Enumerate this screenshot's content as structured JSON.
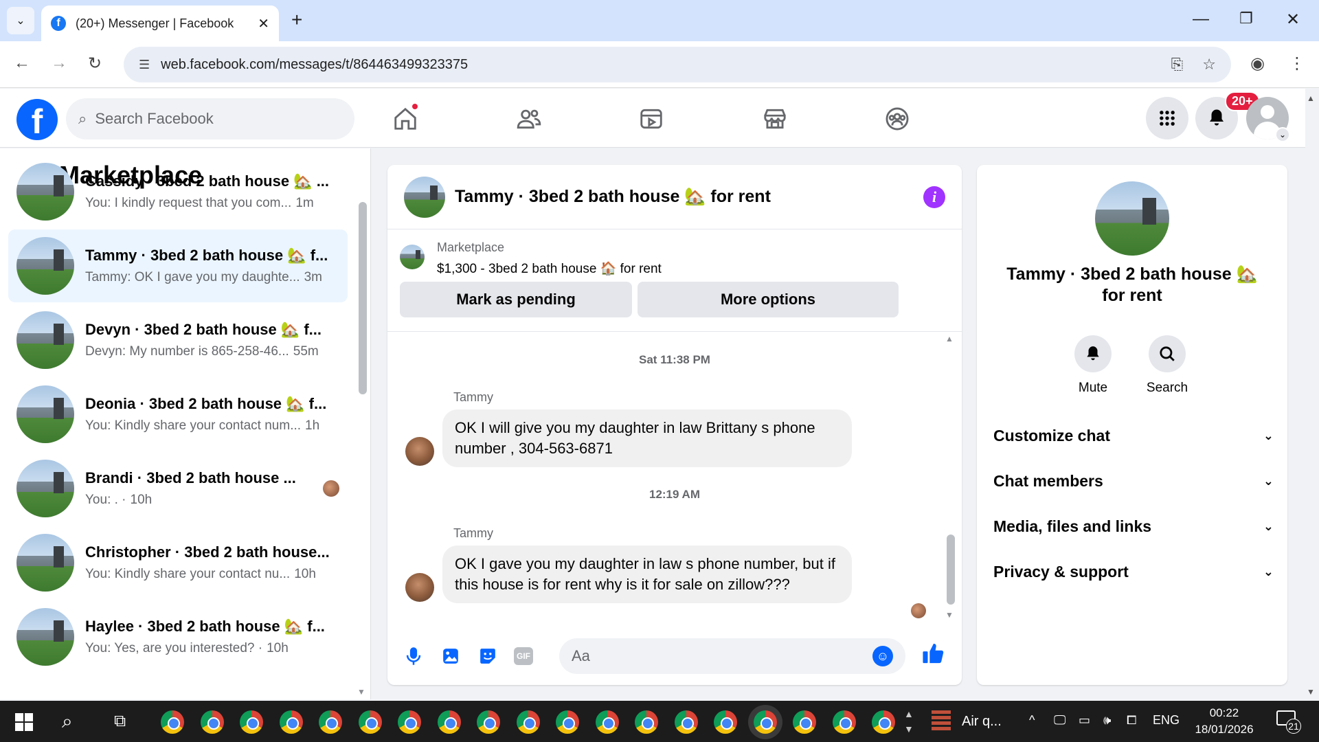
{
  "browser": {
    "tab_title": "(20+) Messenger | Facebook",
    "favicon": "f",
    "url": "web.facebook.com/messages/t/864463499323375",
    "icons": [
      "tab-list-icon",
      "close-icon",
      "new-tab-icon",
      "minimize-icon",
      "restore-icon",
      "window-close-icon",
      "back-icon",
      "forward-icon",
      "reload-icon",
      "site-settings-icon",
      "install-icon",
      "star-icon",
      "profile-icon",
      "kebab-menu-icon"
    ]
  },
  "facebook": {
    "logo": "f",
    "search_placeholder": "Search Facebook",
    "notification_badge": "20+",
    "brand_color": "#0866ff"
  },
  "left_panel": {
    "title": "Marketplace",
    "conversations": [
      {
        "name": "Cassidy · 3bed 2 bath house 🏡 ...",
        "snippet": "You: I kindly request that you com...",
        "time": "1m",
        "active": false
      },
      {
        "name": "Tammy · 3bed 2 bath house 🏡 f...",
        "snippet": "Tammy: OK I gave you my daughte...",
        "time": "3m",
        "active": true
      },
      {
        "name": "Devyn · 3bed 2 bath house 🏡 f...",
        "snippet": "Devyn: My number is 865-258-46...",
        "time": "55m",
        "active": false
      },
      {
        "name": "Deonia · 3bed 2 bath house 🏡 f...",
        "snippet": "You: Kindly share your contact num...",
        "time": "1h",
        "active": false
      },
      {
        "name": "Brandi · 3bed 2 bath house ...",
        "snippet": "You: . ·",
        "time": "10h",
        "active": false
      },
      {
        "name": "Christopher · 3bed 2 bath house...",
        "snippet": "You: Kindly share your contact nu...",
        "time": "10h",
        "active": false
      },
      {
        "name": "Haylee · 3bed 2 bath house 🏡 f...",
        "snippet": "You: Yes, are you interested? ·",
        "time": "10h",
        "active": false
      }
    ]
  },
  "chat": {
    "header_name": "Tammy · 3bed 2 bath house 🏡 for rent",
    "listing_source": "Marketplace",
    "listing_title": "$1,300 - 3bed 2 bath house 🏠 for rent",
    "mark_pending_label": "Mark as pending",
    "more_options_label": "More options",
    "messages": [
      {
        "timestamp": "Sat 11:38 PM",
        "sender": "Tammy",
        "text": "OK I will give you my daughter in law Brittany s phone number  , 304-563-6871"
      },
      {
        "timestamp": "12:19 AM",
        "sender": "Tammy",
        "text": "OK I gave you my daughter in law s phone number,  but if this house  is for rent why is it for sale on zillow???"
      }
    ],
    "composer_placeholder": "Aa",
    "gif_label": "GIF"
  },
  "info_panel": {
    "name": "Tammy · 3bed 2 bath house 🏡 for rent",
    "mute_label": "Mute",
    "search_label": "Search",
    "sections": [
      "Customize chat",
      "Chat members",
      "Media, files and links",
      "Privacy & support"
    ]
  },
  "taskbar": {
    "weather_text": "Air q...",
    "language": "ENG",
    "time": "00:22",
    "date": "18/01/2026",
    "notification_count": "21",
    "chrome_windows": 19
  }
}
